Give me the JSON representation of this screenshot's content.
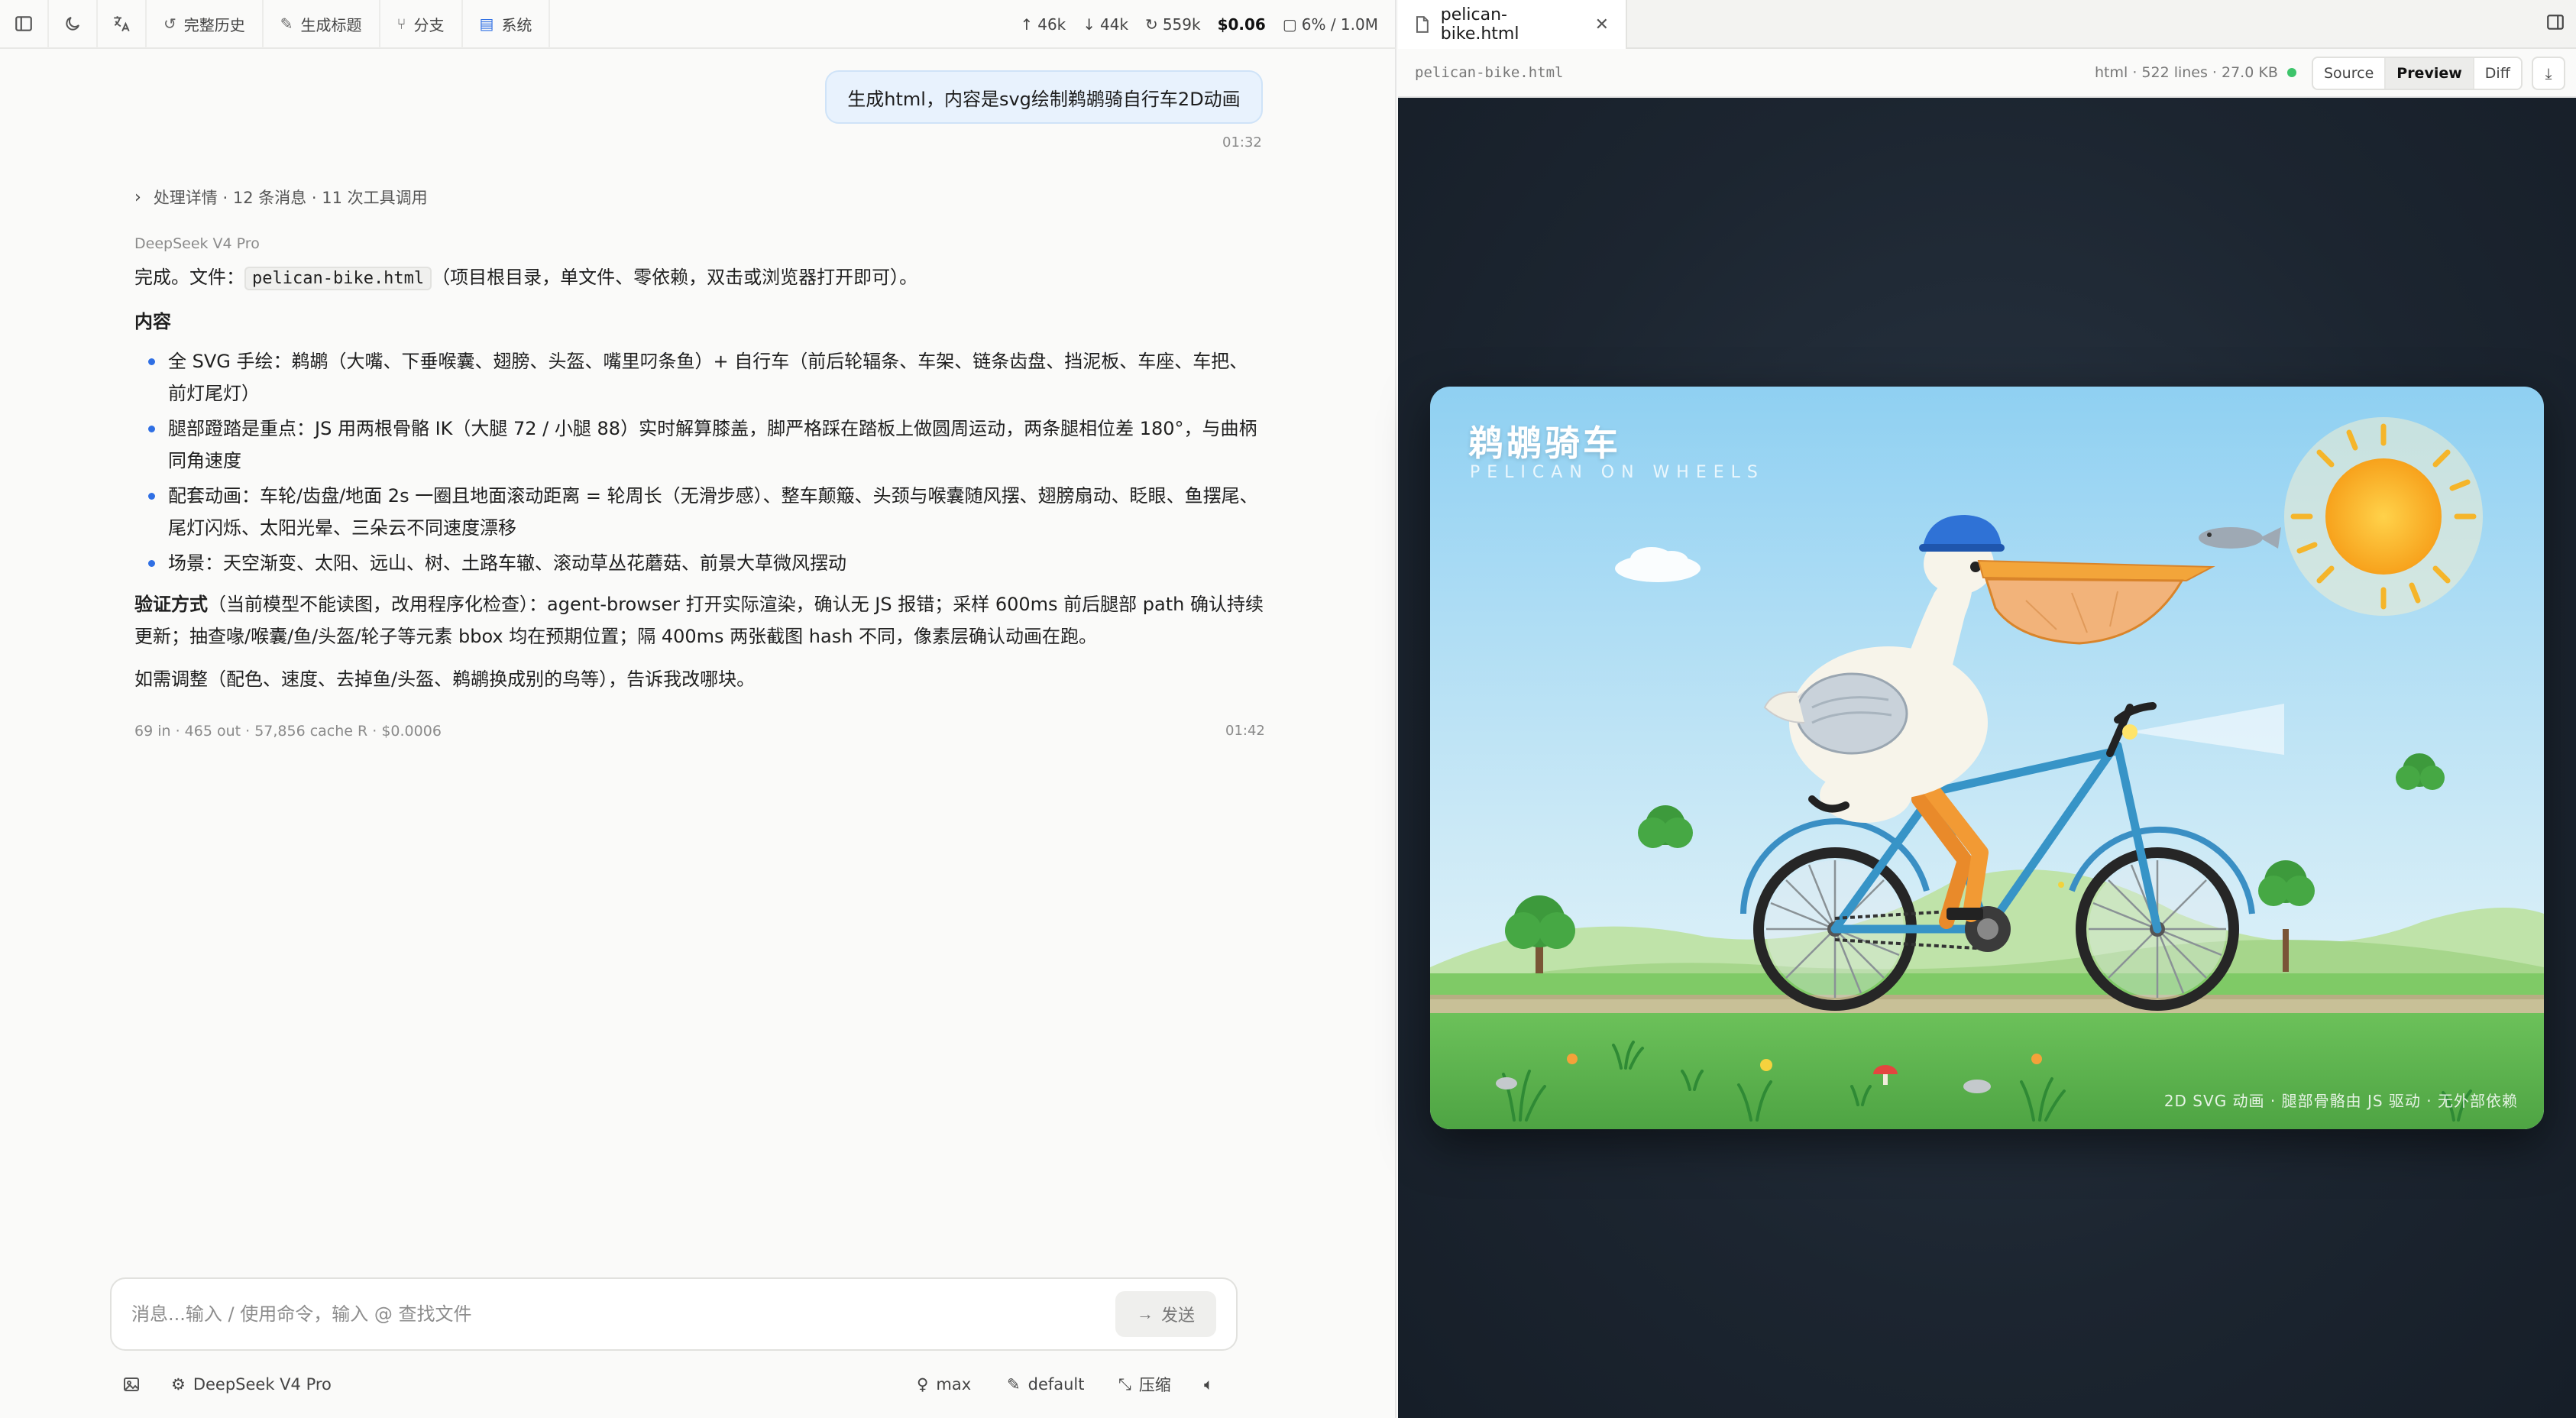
{
  "toolbar": {
    "history": "完整历史",
    "gen_title": "生成标题",
    "branch": "分支",
    "system": "系统"
  },
  "stats": {
    "up": "46k",
    "down": "44k",
    "cache": "559k",
    "cost": "$0.06",
    "context": "6% / 1.0M"
  },
  "chat": {
    "user_message": "生成html，内容是svg绘制鹈鹕骑自行车2D动画",
    "user_time": "01:32",
    "process_summary": "处理详情 · 12 条消息 · 11 次工具调用",
    "model": "DeepSeek V4 Pro",
    "done_prefix": "完成。文件：",
    "file_code": "pelican-bike.html",
    "done_suffix": "（项目根目录，单文件、零依赖，双击或浏览器打开即可）。",
    "content_heading": "内容",
    "bullets": [
      "全 SVG 手绘：鹈鹕（大嘴、下垂喉囊、翅膀、头盔、嘴里叼条鱼）+ 自行车（前后轮辐条、车架、链条齿盘、挡泥板、车座、车把、前灯尾灯）",
      "腿部蹬踏是重点：JS 用两根骨骼 IK（大腿 72 / 小腿 88）实时解算膝盖，脚严格踩在踏板上做圆周运动，两条腿相位差 180°，与曲柄同角速度",
      "配套动画：车轮/齿盘/地面 2s 一圈且地面滚动距离 = 轮周长（无滑步感）、整车颠簸、头颈与喉囊随风摆、翅膀扇动、眨眼、鱼摆尾、尾灯闪烁、太阳光晕、三朵云不同速度漂移",
      "场景：天空渐变、太阳、远山、树、土路车辙、滚动草丛花蘑菇、前景大草微风摆动"
    ],
    "verify_label": "验证方式",
    "verify_text": "（当前模型不能读图，改用程序化检查）：agent-browser 打开实际渲染，确认无 JS 报错；采样 600ms 前后腿部 path 确认持续更新；抽查喙/喉囊/鱼/头盔/轮子等元素 bbox 均在预期位置；隔 400ms 两张截图 hash 不同，像素层确认动画在跑。",
    "adjust_text": "如需调整（配色、速度、去掉鱼/头盔、鹈鹕换成别的鸟等），告诉我改哪块。",
    "reply_meta": "69 in · 465 out · 57,856 cache R · $0.0006",
    "reply_time": "01:42"
  },
  "composer": {
    "placeholder": "消息...输入 / 使用命令，输入 @ 查找文件",
    "send": "发送"
  },
  "bottombar": {
    "model": "DeepSeek V4 Pro",
    "effort": "max",
    "mode": "default",
    "compress": "压缩"
  },
  "preview": {
    "tab_name": "pelican-bike.html",
    "file_path": "pelican-bike.html",
    "file_meta": "html · 522 lines · 27.0 KB",
    "views": [
      "Source",
      "Preview",
      "Diff"
    ],
    "active_view": "Preview",
    "stage_title": "鹈鹕骑车",
    "stage_subtitle": "PELICAN ON WHEELS",
    "stage_footer": "2D SVG 动画 · 腿部骨骼由 JS 驱动 · 无外部依赖"
  },
  "colors": {
    "accent": "#2f6fe4",
    "bubble": "#e8f2fd",
    "status_dot": "#3dc46b",
    "preview_bg": "#1d2732"
  }
}
